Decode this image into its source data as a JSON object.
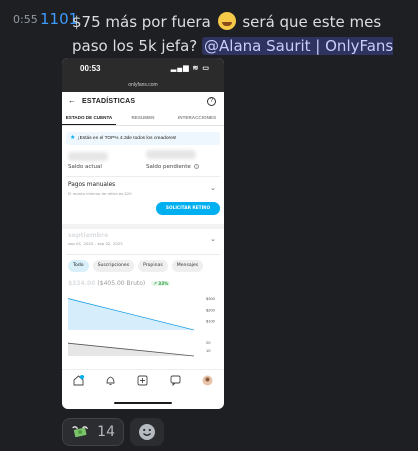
{
  "message": {
    "timestamp": "0:55",
    "count": "1101",
    "text_before": "$75 más por fuera",
    "text_after": "será que este mes paso los 5k jefa?",
    "mention": "@Alana Saurit | OnlyFans Coach"
  },
  "phone": {
    "time": "00:53",
    "status_icons": "▂▄▆ ≋ ▭",
    "url": "onlyfans.com",
    "app": {
      "title": "ESTADÍSTICAS",
      "tabs": [
        "ESTADO DE CUENTA",
        "RESUMEN",
        "INTERACCIONES"
      ],
      "banner": "¡Estás en el TOP% 4.3de todos los creadores!",
      "saldo_actual": "Saldo actual",
      "saldo_pendiente": "Saldo pendiente",
      "pagos_title": "Pagos manuales",
      "pagos_sub": "El monto mínimo de retiro es $20",
      "retiro_button": "SOLICITAR RETIRO",
      "period": "septiembre",
      "period_range": "sep 01, 2025 - sep 02, 2025",
      "chips": [
        "Todo",
        "Suscripciones",
        "Propinas",
        "Mensajes"
      ],
      "net_amount": "$324.00",
      "gross_amount": "($405.00 Bruto)",
      "change": "↗ 33%"
    }
  },
  "chart_data": [
    {
      "type": "area",
      "x": [
        1,
        2
      ],
      "series": [
        {
          "values": [
            324,
            0
          ]
        }
      ],
      "ytick_labels": [
        "$300",
        "$200",
        "$100"
      ],
      "ylim": [
        0,
        350
      ],
      "colors": {
        "line": "#1aa0e6",
        "fill": "#d6eefb"
      }
    },
    {
      "type": "area",
      "x": [
        1,
        2
      ],
      "series": [
        {
          "values": [
            24,
            0
          ]
        }
      ],
      "ytick_labels": [
        "20",
        "10"
      ],
      "ylim": [
        0,
        30
      ],
      "colors": {
        "line": "#555555",
        "fill": "#e6e6e6"
      }
    }
  ],
  "reactions": [
    {
      "emoji": "money-wings",
      "count": "14"
    }
  ],
  "icons": [
    "castle-icon",
    "star-icon",
    "help-icon",
    "back-arrow-icon",
    "home-icon",
    "bell-icon",
    "add-post-icon",
    "messages-icon",
    "avatar-icon",
    "money-emoji-icon",
    "add-reaction-icon"
  ]
}
